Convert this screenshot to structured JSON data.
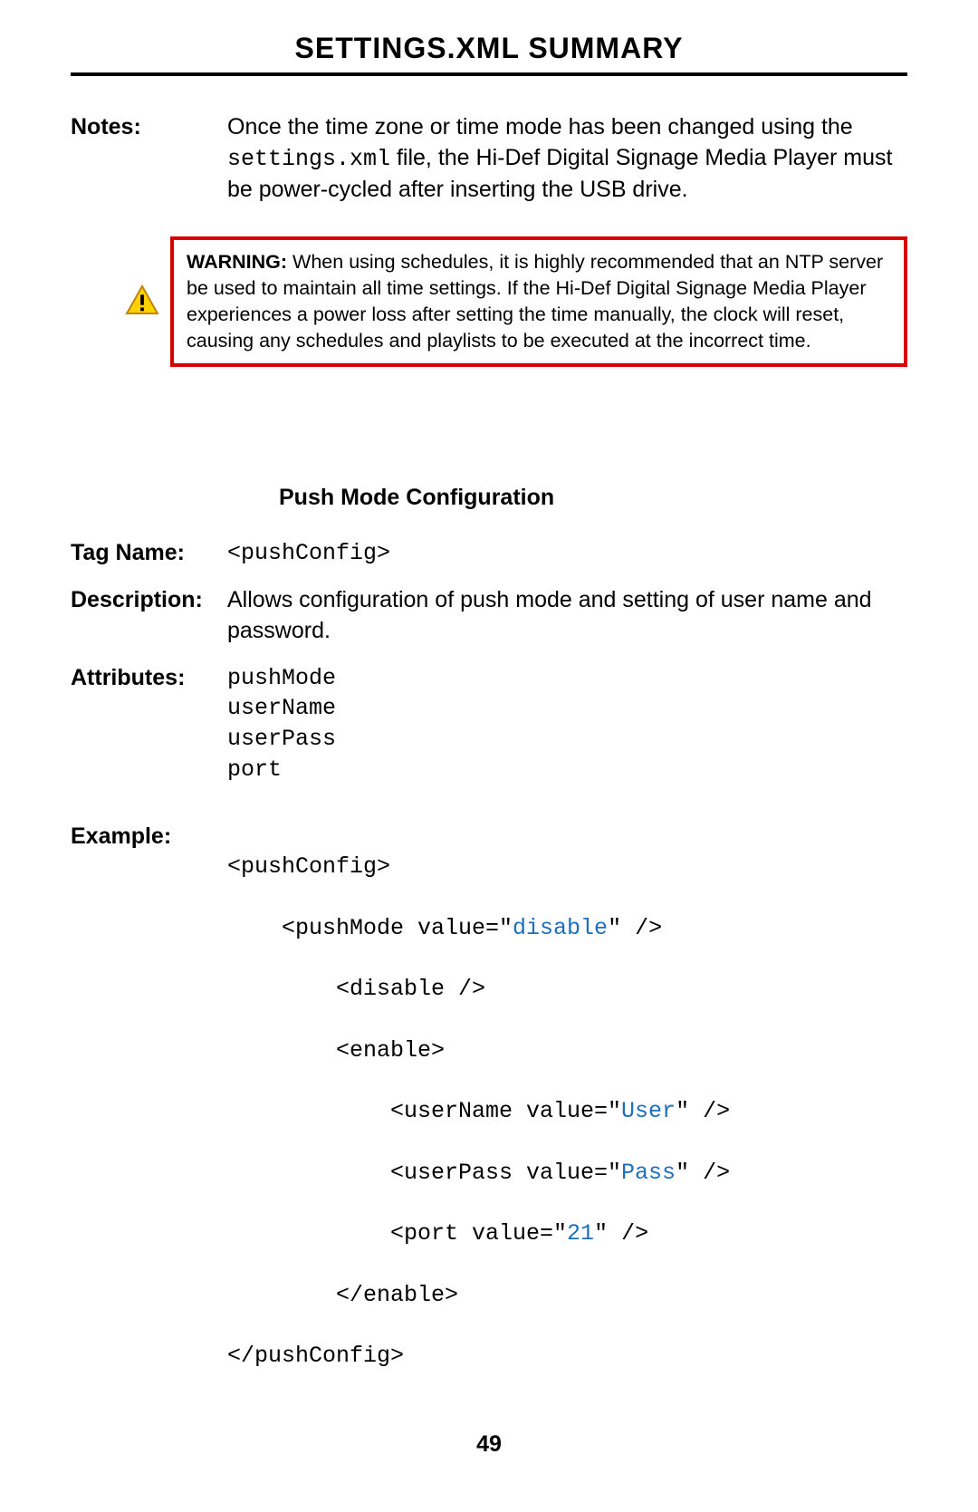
{
  "title": "SETTINGS.XML SUMMARY",
  "notesLabel": "Notes:",
  "notes_pre": "Once the time zone or time mode has been changed using the ",
  "notes_code": "settings.xml",
  "notes_post": " file, the Hi-Def Digital Signage Media Player must be power-cycled after  inserting the USB drive.",
  "warnLabel": "WARNING:",
  "warnText": " When using schedules, it is highly recommended that an NTP server be used to maintain all time settings.  If the Hi-Def Digital Signage Media Player experiences a power loss after setting the time manually, the clock will reset, causing any schedules and playlists to be executed at the incorrect time.",
  "sectionHdr": "Push Mode Configuration",
  "tagNameLabel": "Tag Name",
  "tagNameValue": "<pushConfig>",
  "descLabel": "Description",
  "descValue": "Allows configuration of push mode and setting of user name and password.",
  "attrLabel": "Attributes",
  "attrs": [
    "pushMode",
    "userName",
    "userPass",
    "port"
  ],
  "exLabel": "Example",
  "ex": {
    "l1": "<pushConfig>",
    "l2a": "<pushMode value=\"",
    "l2b": "disable",
    "l2c": "\" />",
    "l3": "<disable />",
    "l4": "<enable>",
    "l5a": "<userName value=\"",
    "l5b": "User",
    "l5c": "\" />",
    "l6a": "<userPass value=\"",
    "l6b": "Pass",
    "l6c": "\" />",
    "l7a": "<port value=\"",
    "l7b": "21",
    "l7c": "\" />",
    "l8": "</enable>",
    "l9": "</pushConfig>"
  },
  "pageNum": "49",
  "colon": ":"
}
